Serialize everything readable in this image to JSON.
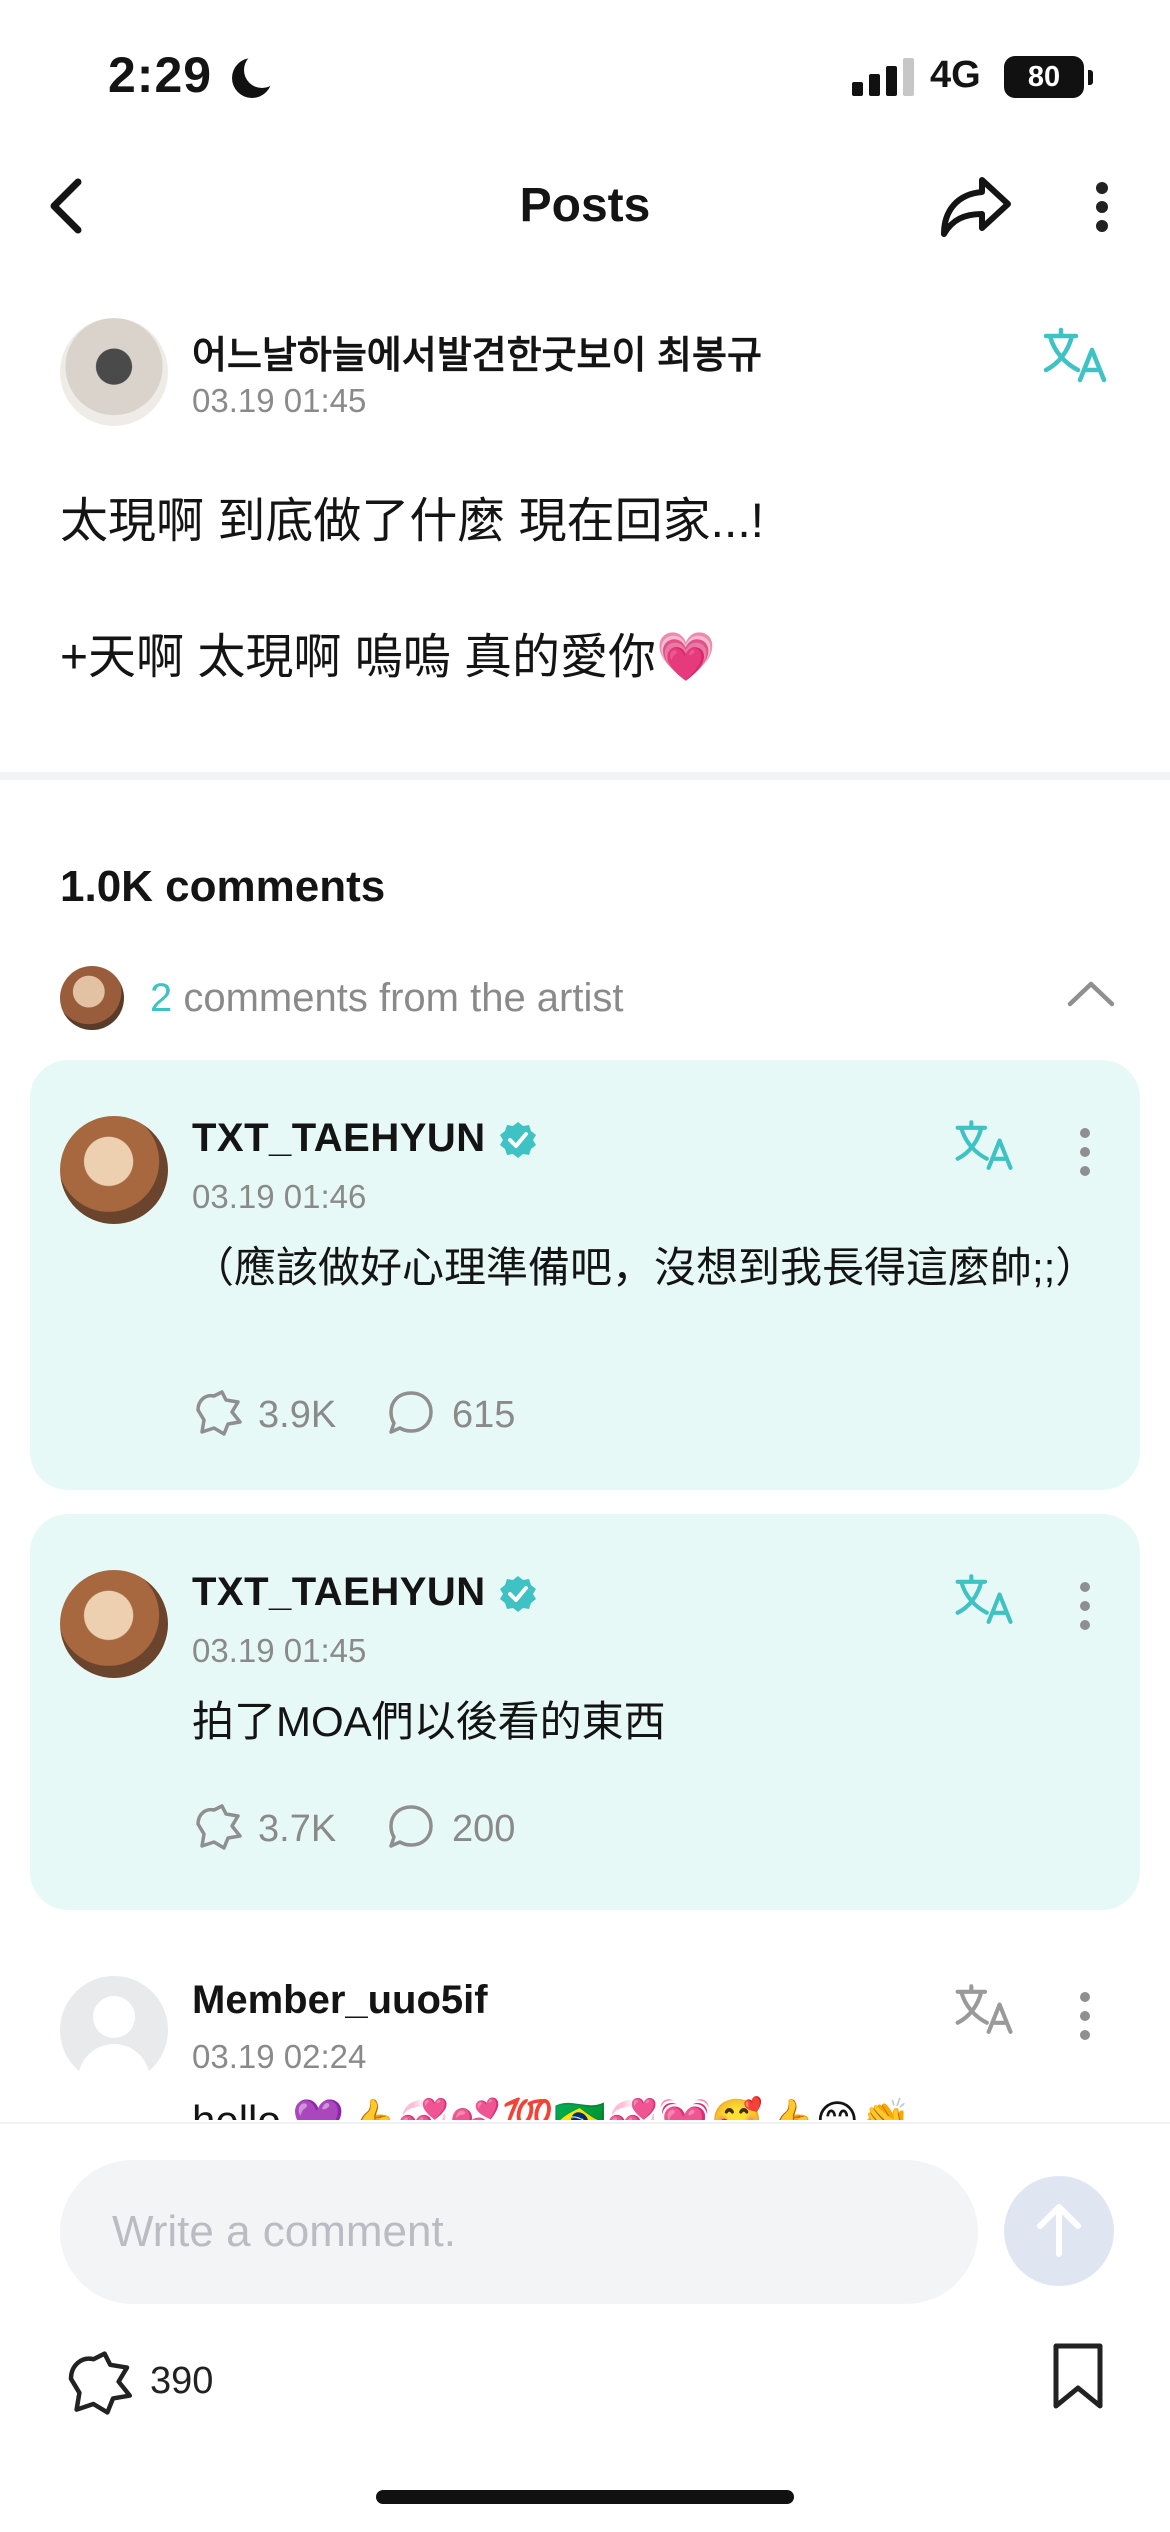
{
  "status_bar": {
    "time": "2:29",
    "network": "4G",
    "battery": "80"
  },
  "nav": {
    "title": "Posts"
  },
  "post": {
    "author": "어느날하늘에서발견한굿보이 최봉규",
    "time": "03.19 01:45",
    "body": "太現啊 到底做了什麼 現在回家...!\n\n+天啊 太現啊 嗚嗚 真的愛你💗"
  },
  "comments_section": {
    "count_label": "1.0K comments",
    "artist_count": "2",
    "artist_label": " comments from the artist"
  },
  "artist_comments": [
    {
      "name": "TXT_TAEHYUN",
      "time": "03.19 01:46",
      "body": "（應該做好心理準備吧，沒想到我長得這麼帥;;）",
      "likes": "3.9K",
      "replies": "615"
    },
    {
      "name": "TXT_TAEHYUN",
      "time": "03.19 01:45",
      "body": "拍了MOA們以後看的東西",
      "likes": "3.7K",
      "replies": "200"
    }
  ],
  "regular_comment": {
    "name": "Member_uuo5if",
    "time": "03.19 02:24",
    "body": "hello 💜👍💞💕💯🇧🇷💞💓🥰👍😊👏"
  },
  "composer": {
    "placeholder": "Write a comment."
  },
  "footer": {
    "like_count": "390"
  },
  "colors": {
    "accent": "#3fc2c3",
    "card_bg": "#e7f9f6",
    "muted": "#8a8a8a"
  }
}
